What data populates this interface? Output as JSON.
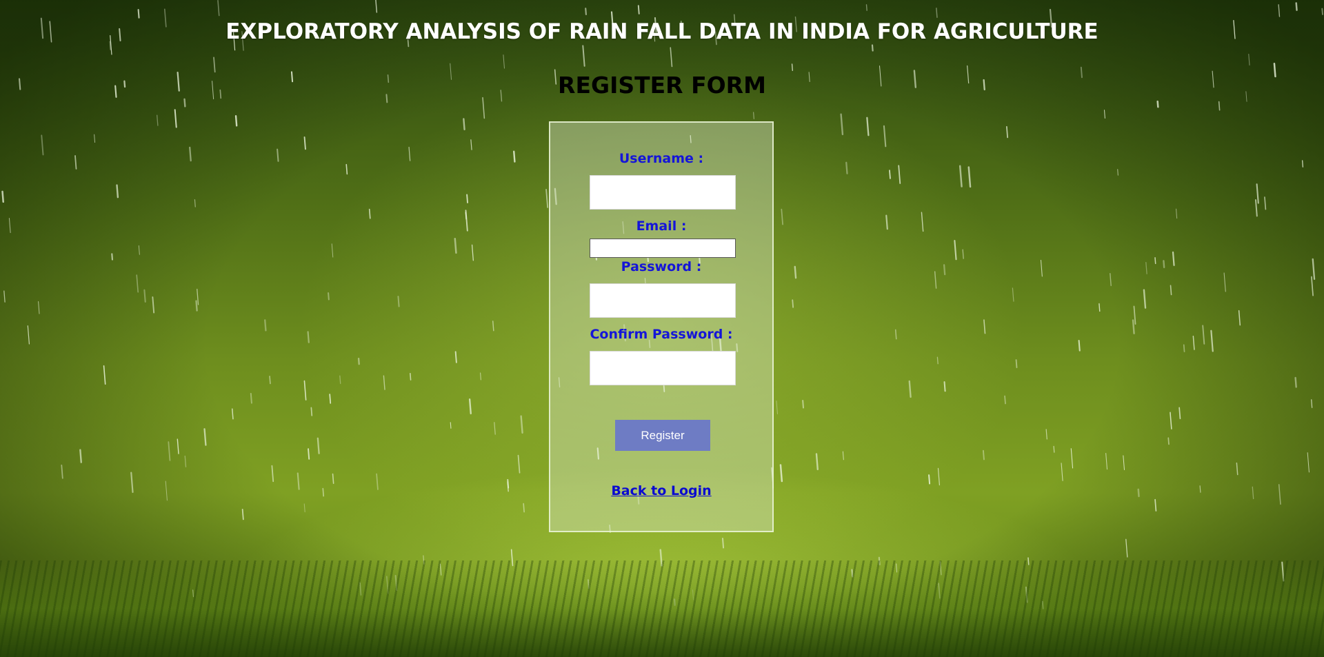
{
  "header": {
    "title": "EXPLORATORY ANALYSIS OF RAIN FALL DATA IN INDIA FOR AGRICULTURE",
    "form_heading": "REGISTER FORM"
  },
  "form": {
    "username_label": "Username :",
    "username_value": "",
    "email_label": "Email :",
    "email_value": "",
    "password_label": "Password :",
    "password_value": "",
    "confirm_password_label": "Confirm Password :",
    "confirm_password_value": "",
    "register_label": "Register",
    "back_link_label": "Back to Login"
  },
  "colors": {
    "label": "#1515d8",
    "button": "#6e7cc4",
    "link": "#0a0ad0"
  }
}
